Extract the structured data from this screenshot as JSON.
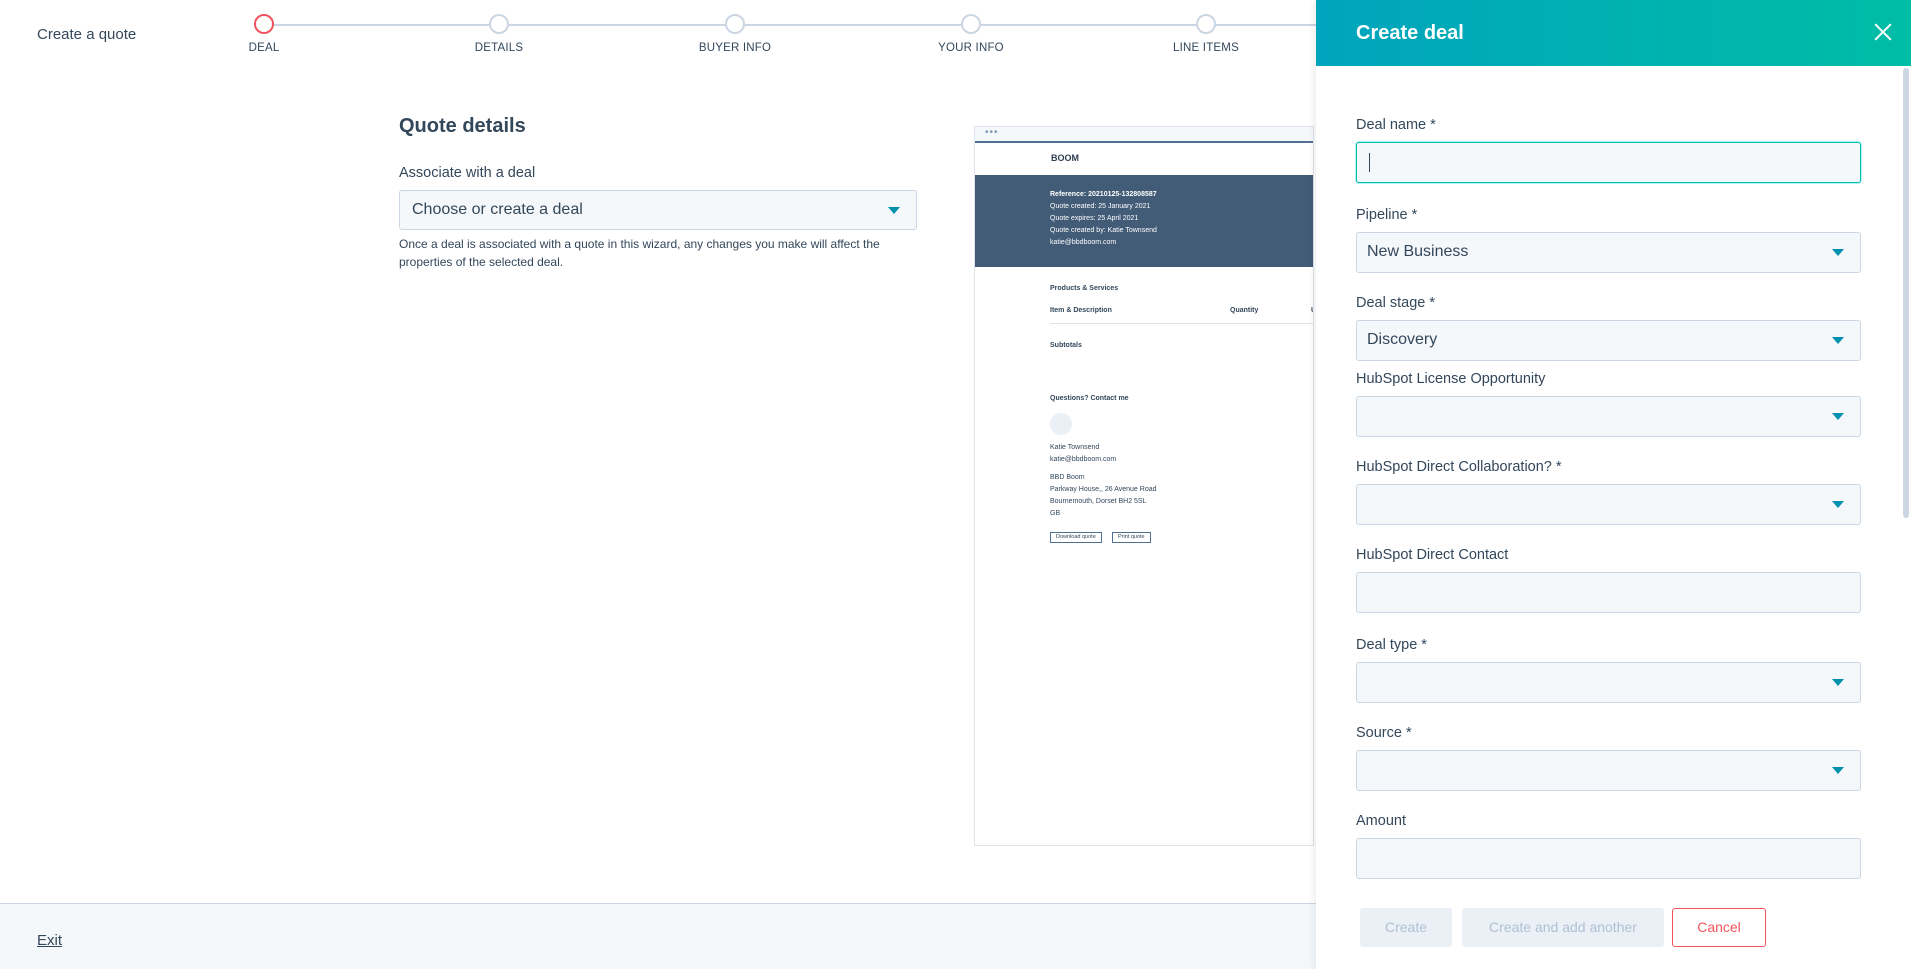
{
  "app": {
    "title": "Create a quote"
  },
  "stepper": {
    "steps": [
      {
        "label": "DEAL",
        "active": true
      },
      {
        "label": "DETAILS",
        "active": false
      },
      {
        "label": "BUYER INFO",
        "active": false
      },
      {
        "label": "YOUR INFO",
        "active": false
      },
      {
        "label": "LINE ITEMS",
        "active": false
      }
    ]
  },
  "main": {
    "title": "Quote details",
    "associate_label": "Associate with a deal",
    "associate_placeholder": "Choose or create a deal",
    "associate_help": "Once a deal is associated with a quote in this wizard, any changes you make will affect the properties of the selected deal."
  },
  "preview": {
    "bar_dots": "•••",
    "logo": "BOOM",
    "reference": "Reference: 20210125-132808587",
    "created": "Quote created: 25 January 2021",
    "expires": "Quote expires: 25 April 2021",
    "created_by": "Quote created by: Katie Townsend",
    "email": "katie@bbdboom.com",
    "products_title": "Products & Services",
    "col_item": "Item & Description",
    "col_quantity": "Quantity",
    "col_u": "U",
    "subtotals": "Subtotals",
    "contact_title": "Questions? Contact me",
    "contact_name": "Katie Townsend",
    "contact_email": "katie@bbdboom.com",
    "company": "BBD Boom",
    "address1": "Parkway House,, 26 Avenue Road",
    "address2": "Bournemouth, Dorset BH2 5SL",
    "country": "GB",
    "download_btn": "Download quote",
    "print_btn": "Print quote"
  },
  "footer": {
    "exit_label": "Exit"
  },
  "panel": {
    "title": "Create deal",
    "fields": {
      "deal_name": {
        "label": "Deal name *",
        "value": ""
      },
      "pipeline": {
        "label": "Pipeline *",
        "value": "New Business"
      },
      "deal_stage": {
        "label": "Deal stage *",
        "value": "Discovery"
      },
      "license_opportunity": {
        "label": "HubSpot License Opportunity",
        "value": ""
      },
      "direct_collaboration": {
        "label": "HubSpot Direct Collaboration? *",
        "value": ""
      },
      "direct_contact": {
        "label": "HubSpot Direct Contact",
        "value": ""
      },
      "deal_type": {
        "label": "Deal type *",
        "value": ""
      },
      "source": {
        "label": "Source *",
        "value": ""
      },
      "amount": {
        "label": "Amount",
        "value": ""
      }
    },
    "buttons": {
      "create": "Create",
      "create_another": "Create and add another",
      "cancel": "Cancel"
    }
  },
  "colors": {
    "header_gradient_start": "#00a4bd",
    "header_gradient_end": "#00bda5",
    "active_step": "#f2545b",
    "cancel": "#f2545b",
    "caret": "#0091ae"
  }
}
